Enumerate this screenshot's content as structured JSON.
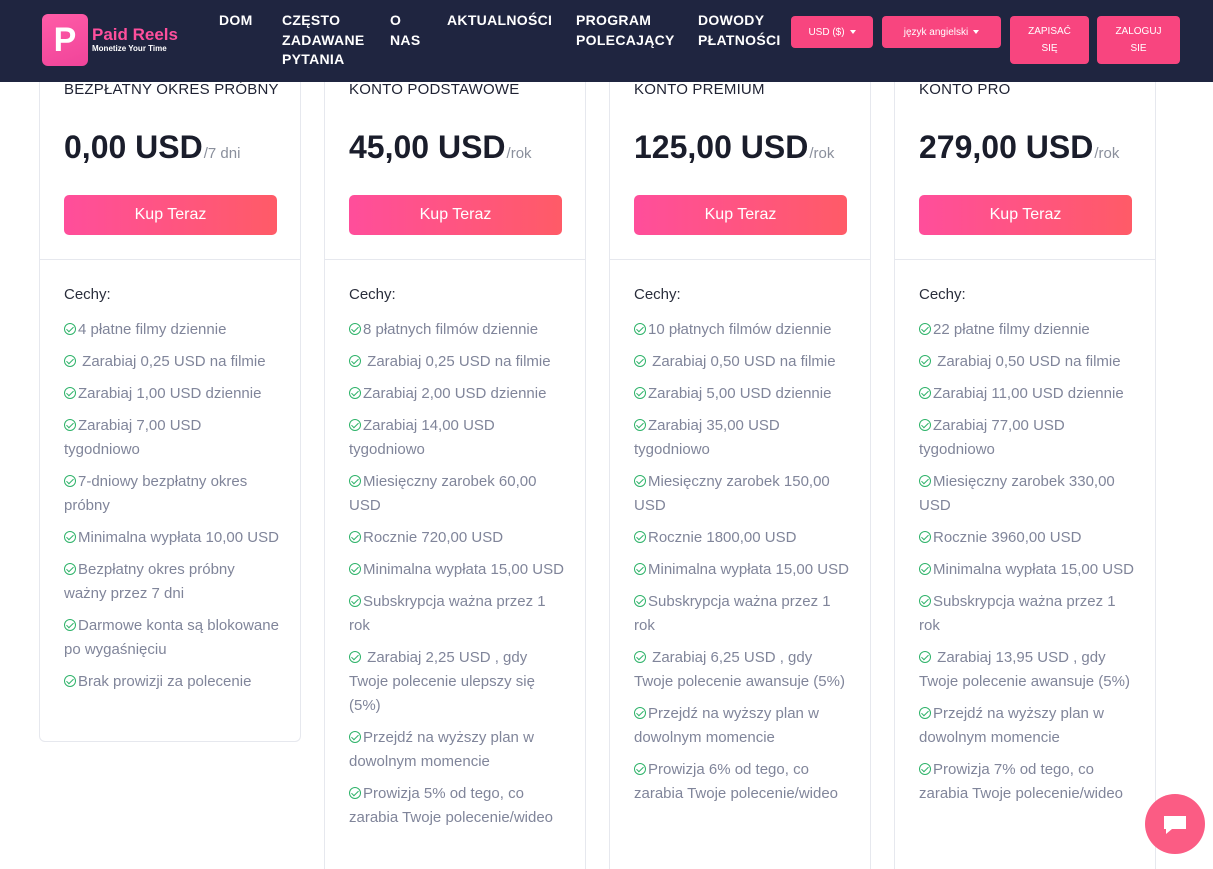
{
  "brand": {
    "mark": "P",
    "name": "Paid Reels",
    "tagline": "Monetize Your Time"
  },
  "nav": [
    {
      "label": "DOM"
    },
    {
      "label": "CZĘSTO ZADAWANE PYTANIA"
    },
    {
      "label": "O NAS"
    },
    {
      "label": "AKTUALNOŚCI"
    },
    {
      "label": "PROGRAM POLECAJĄCY"
    },
    {
      "label": "DOWODY PŁATNOŚCI"
    }
  ],
  "header_controls": {
    "currency": "USD ($)",
    "language": "język angielski",
    "signup": "ZAPISAĆ SIĘ",
    "login": "ZALOGUJ SIE"
  },
  "features_heading": "Cechy:",
  "buy_label": "Kup Teraz",
  "plans": [
    {
      "name": "BEZPŁATNY OKRES PRÓBNY",
      "price": "0,00 USD",
      "period": "/7 dni",
      "features": [
        "4 płatne filmy dziennie",
        " Zarabiaj 0,25 USD na filmie",
        "Zarabiaj 1,00 USD dziennie",
        "Zarabiaj 7,00 USD tygodniowo",
        "7-dniowy bezpłatny okres próbny",
        "Minimalna wypłata 10,00 USD",
        "Bezpłatny okres próbny ważny przez 7 dni",
        "Darmowe konta są blokowane po wygaśnięciu",
        "Brak prowizji za polecenie"
      ]
    },
    {
      "name": "KONTO PODSTAWOWE",
      "price": "45,00 USD",
      "period": "/rok",
      "features": [
        "8 płatnych filmów dziennie",
        " Zarabiaj 0,25 USD na filmie",
        "Zarabiaj 2,00 USD dziennie",
        "Zarabiaj 14,00 USD tygodniowo",
        "Miesięczny zarobek 60,00 USD",
        "Rocznie 720,00 USD",
        "Minimalna wypłata 15,00 USD",
        "Subskrypcja ważna przez 1 rok",
        " Zarabiaj 2,25 USD , gdy Twoje polecenie ulepszy się (5%)",
        "Przejdź na wyższy plan w dowolnym momencie",
        "Prowizja 5% od tego, co zarabia Twoje polecenie/wideo"
      ]
    },
    {
      "name": "KONTO PREMIUM",
      "price": "125,00 USD",
      "period": "/rok",
      "features": [
        "10 płatnych filmów dziennie",
        " Zarabiaj 0,50 USD na filmie",
        "Zarabiaj 5,00 USD dziennie",
        "Zarabiaj 35,00 USD tygodniowo",
        "Miesięczny zarobek 150,00 USD",
        "Rocznie 1800,00 USD",
        "Minimalna wypłata 15,00 USD",
        "Subskrypcja ważna przez 1 rok",
        " Zarabiaj 6,25 USD , gdy Twoje polecenie awansuje (5%)",
        "Przejdź na wyższy plan w dowolnym momencie",
        "Prowizja 6% od tego, co zarabia Twoje polecenie/wideo"
      ]
    },
    {
      "name": "KONTO PRO",
      "price": "279,00 USD",
      "period": "/rok",
      "features": [
        "22 płatne filmy dziennie",
        " Zarabiaj 0,50 USD na filmie",
        "Zarabiaj 11,00 USD dziennie",
        "Zarabiaj 77,00 USD tygodniowo",
        "Miesięczny zarobek 330,00 USD",
        "Rocznie 3960,00 USD",
        "Minimalna wypłata 15,00 USD",
        "Subskrypcja ważna przez 1 rok",
        " Zarabiaj 13,95 USD , gdy Twoje polecenie awansuje (5%)",
        "Przejdź na wyższy plan w dowolnym momencie",
        "Prowizja 7% od tego, co zarabia Twoje polecenie/wideo"
      ]
    }
  ],
  "colors": {
    "header_bg": "#1f2540",
    "accent": "#f8457f",
    "check": "#2fb36a"
  },
  "icons": {
    "feature": "check-circle-icon",
    "chat": "chat-bubble-icon"
  }
}
